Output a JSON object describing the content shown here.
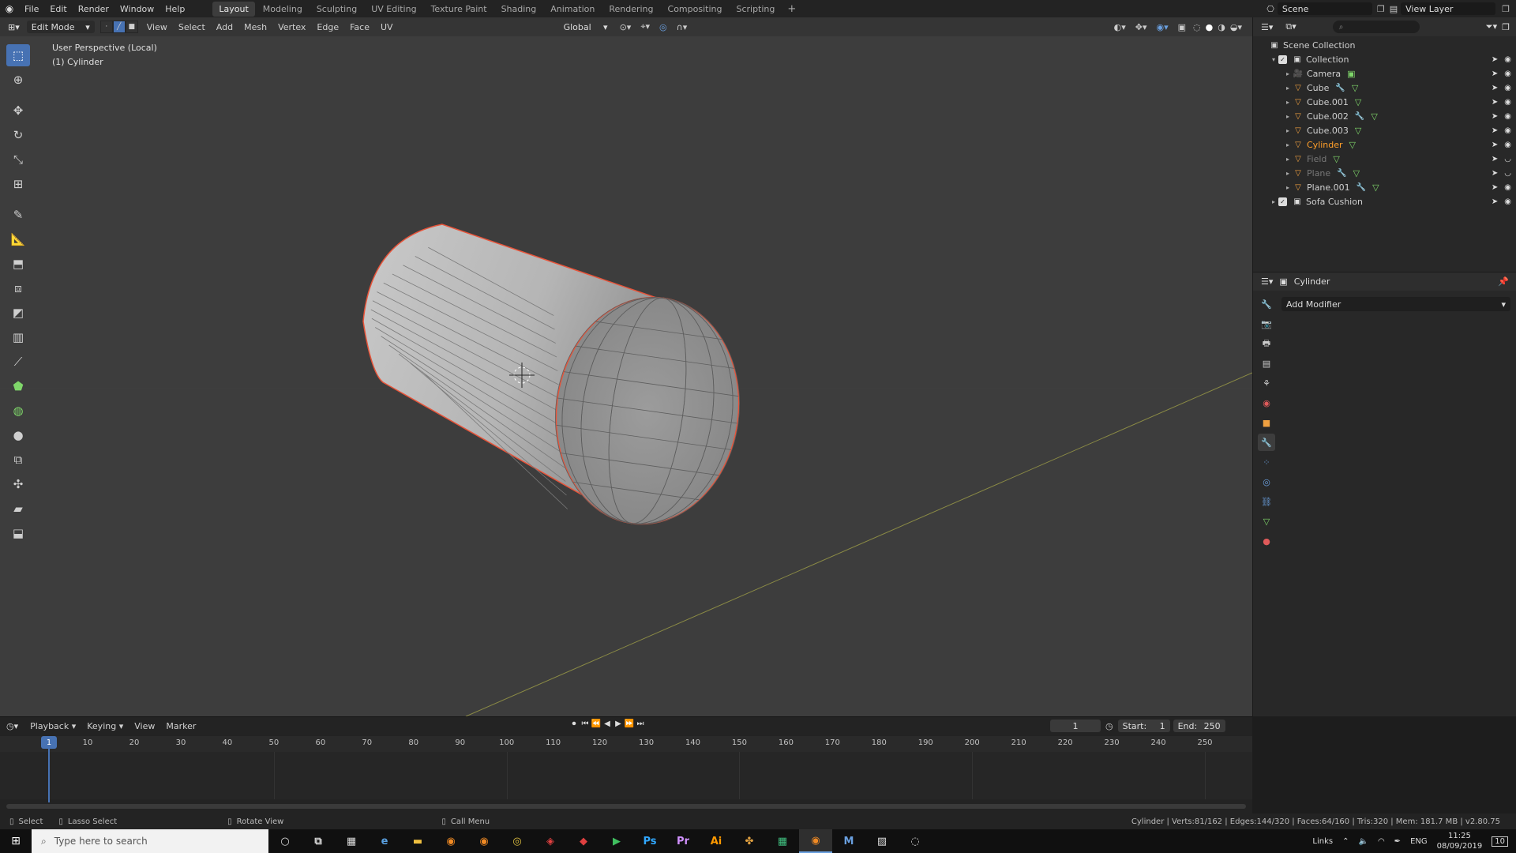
{
  "topbar": {
    "menus": [
      "File",
      "Edit",
      "Render",
      "Window",
      "Help"
    ],
    "workspaces": [
      {
        "label": "Layout",
        "active": true
      },
      {
        "label": "Modeling"
      },
      {
        "label": "Sculpting"
      },
      {
        "label": "UV Editing"
      },
      {
        "label": "Texture Paint"
      },
      {
        "label": "Shading"
      },
      {
        "label": "Animation"
      },
      {
        "label": "Rendering"
      },
      {
        "label": "Compositing"
      },
      {
        "label": "Scripting"
      }
    ],
    "add_label": "+",
    "scene": "Scene",
    "view_layer": "View Layer"
  },
  "viewport": {
    "mode": "Edit Mode",
    "menus": [
      "View",
      "Select",
      "Add",
      "Mesh",
      "Vertex",
      "Edge",
      "Face",
      "UV"
    ],
    "orientation": "Global",
    "perspective_label": "User Perspective (Local)",
    "object_label": "(1) Cylinder"
  },
  "toolbar": {
    "tools": [
      "select-box",
      "cursor",
      "move",
      "rotate",
      "scale",
      "transform",
      "annotate",
      "measure",
      "extrude",
      "inset",
      "bevel",
      "loop-cut",
      "knife",
      "poly-build",
      "spin",
      "smooth",
      "edge-slide",
      "shrink-fatten",
      "shear",
      "rip"
    ]
  },
  "outliner": {
    "root": "Scene Collection",
    "items": [
      {
        "label": "Collection",
        "type": "collection",
        "level": 0
      },
      {
        "label": "Camera",
        "type": "camera",
        "level": 1
      },
      {
        "label": "Cube",
        "type": "mesh",
        "level": 1,
        "modifier": true
      },
      {
        "label": "Cube.001",
        "type": "mesh",
        "level": 1
      },
      {
        "label": "Cube.002",
        "type": "mesh",
        "level": 1,
        "modifier": true
      },
      {
        "label": "Cube.003",
        "type": "mesh",
        "level": 1
      },
      {
        "label": "Cylinder",
        "type": "mesh",
        "level": 1,
        "selected": true
      },
      {
        "label": "Field",
        "type": "mesh",
        "level": 1,
        "dim": true
      },
      {
        "label": "Plane",
        "type": "mesh",
        "level": 1,
        "dim": true,
        "modifier": true
      },
      {
        "label": "Plane.001",
        "type": "mesh",
        "level": 1,
        "modifier": true
      },
      {
        "label": "Sofa Cushion",
        "type": "collection",
        "level": 0
      }
    ]
  },
  "properties": {
    "object_name": "Cylinder",
    "add_modifier": "Add Modifier"
  },
  "timeline": {
    "menus": [
      "Playback",
      "Keying",
      "View",
      "Marker"
    ],
    "current_frame": "1",
    "start_label": "Start:",
    "start": "1",
    "end_label": "End:",
    "end": "250",
    "ticks": [
      "1",
      "10",
      "20",
      "30",
      "40",
      "50",
      "60",
      "70",
      "80",
      "90",
      "100",
      "110",
      "120",
      "130",
      "140",
      "150",
      "160",
      "170",
      "180",
      "190",
      "200",
      "210",
      "220",
      "230",
      "240",
      "250"
    ]
  },
  "statusbar": {
    "select": "Select",
    "lasso": "Lasso Select",
    "rotate": "Rotate View",
    "call_menu": "Call Menu",
    "stats": "Cylinder | Verts:81/162 | Edges:144/320 | Faces:64/160 | Tris:320 | Mem: 181.7 MB | v2.80.75"
  },
  "taskbar": {
    "search_placeholder": "Type here to search",
    "apps": [
      "Ps",
      "Pr",
      "Ai"
    ],
    "tray_links": "Links",
    "lang": "ENG",
    "time": "11:25",
    "date": "08/09/2019",
    "notifications": "10"
  },
  "colors": {
    "accent": "#4772b3",
    "selected_object": "#ff9f2a",
    "edge_selected": "#e8543a"
  }
}
